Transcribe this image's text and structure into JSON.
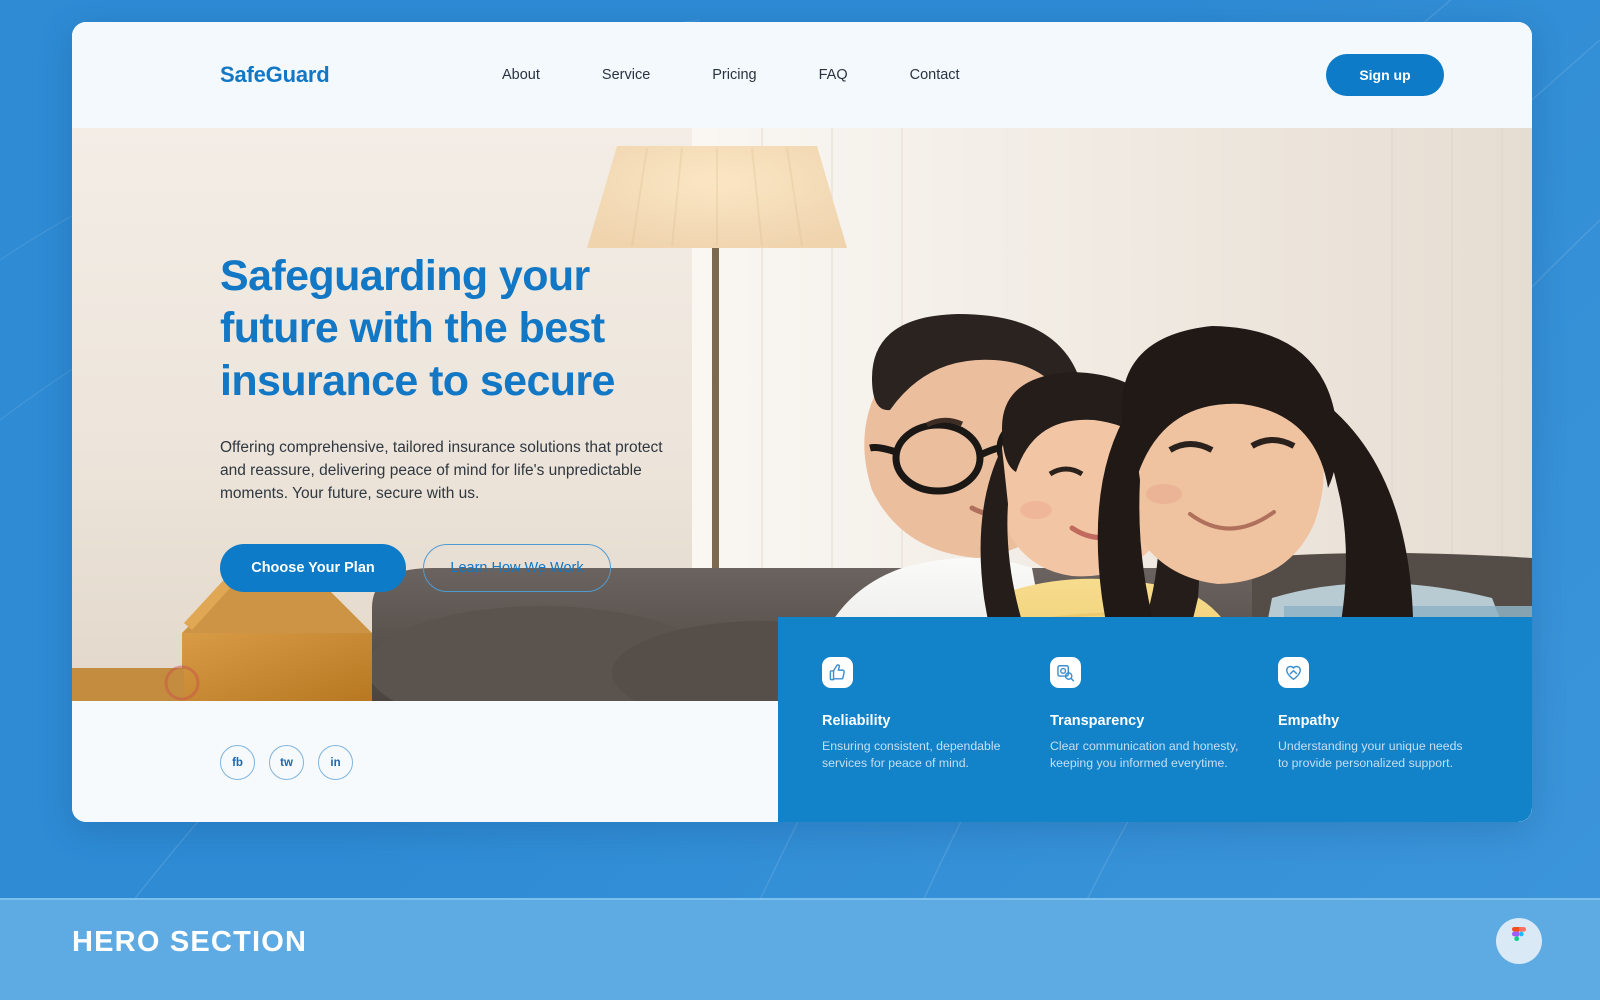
{
  "backdrop": {
    "color": "#2E8BD4"
  },
  "navbar": {
    "logo": "SafeGuard",
    "links": [
      {
        "label": "About"
      },
      {
        "label": "Service"
      },
      {
        "label": "Pricing"
      },
      {
        "label": "FAQ"
      },
      {
        "label": "Contact"
      }
    ],
    "signup_label": "Sign up",
    "accent_color": "#0D7BC7"
  },
  "hero": {
    "headline": "Safeguarding your future with the best insurance to secure",
    "subcopy": "Offering comprehensive, tailored insurance solutions that protect and reassure, delivering peace of mind for life's unpredictable moments. Your future, secure with us.",
    "cta_primary": "Choose Your Plan",
    "cta_secondary": "Learn How We Work",
    "headline_color": "#1277C4",
    "image_alt": "family-hugging-on-sofa-photo"
  },
  "socials": [
    {
      "label": "fb",
      "name": "facebook"
    },
    {
      "label": "tw",
      "name": "twitter"
    },
    {
      "label": "in",
      "name": "linkedin"
    }
  ],
  "features": {
    "panel_color": "#1282C9",
    "items": [
      {
        "icon": "thumbs-up-icon",
        "title": "Reliability",
        "desc": "Ensuring consistent, dependable services for peace of mind."
      },
      {
        "icon": "magnifier-document-icon",
        "title": "Transparency",
        "desc": "Clear communication and honesty, keeping you informed everytime."
      },
      {
        "icon": "heart-hands-icon",
        "title": "Empathy",
        "desc": "Understanding your unique needs to provide personalized support."
      }
    ]
  },
  "bottom_bar": {
    "caption": "HERO SECTION",
    "bar_color": "#5EAAE2",
    "badge": "figma-logo-icon"
  }
}
